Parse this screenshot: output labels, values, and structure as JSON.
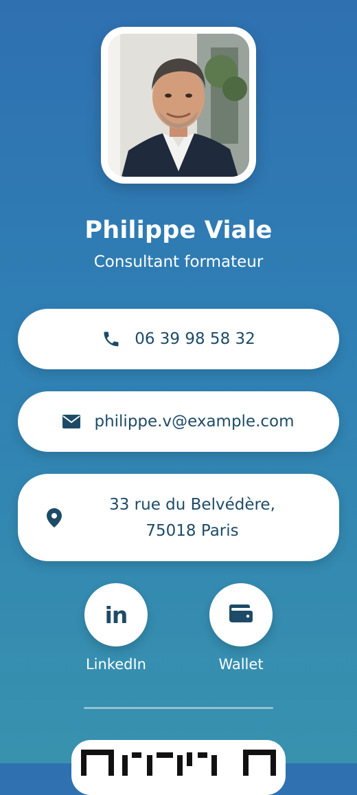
{
  "profile": {
    "photo_icon": "portrait-photo",
    "name": "Philippe Viale",
    "title": "Consultant formateur"
  },
  "contacts": {
    "phone": {
      "icon": "phone-icon",
      "value": "06 39 98 58 32"
    },
    "email": {
      "icon": "envelope-icon",
      "value": "philippe.v@example.com"
    },
    "address": {
      "icon": "map-pin-icon",
      "line1": "33 rue du Belvédère,",
      "line2": "75018 Paris"
    }
  },
  "social": {
    "linkedin": {
      "icon": "linkedin-icon",
      "glyph": "in",
      "label": "LinkedIn"
    },
    "wallet": {
      "icon": "wallet-icon",
      "label": "Wallet"
    }
  },
  "qr": {
    "icon": "qr-code"
  },
  "colors": {
    "background_top": "#2f70b1",
    "background_bottom": "#3892ae",
    "accent_text": "#1d4b67",
    "card": "#ffffff"
  }
}
